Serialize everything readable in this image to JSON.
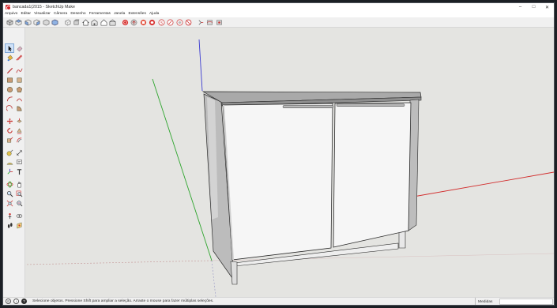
{
  "window": {
    "title": "bancada1(2015 - SketchUp Make",
    "controls": [
      "–",
      "□",
      "✕"
    ]
  },
  "menubar": {
    "items": [
      "Arquivo",
      "Editar",
      "Visualizar",
      "Câmera",
      "Desenho",
      "Ferramentas",
      "Janela",
      "Extensões",
      "Ajuda"
    ]
  },
  "toolbar": {
    "icons": [
      "iso-view-icon",
      "top-view-icon",
      "front-view-icon",
      "right-view-icon",
      "back-view-icon",
      "left-view-icon",
      "xray-style-icon",
      "wireframe-style-icon",
      "hidden-line-style-icon",
      "shaded-style-icon",
      "textured-style-icon",
      "monochrome-style-icon",
      "warehouse-icon",
      "share-model-icon",
      "extension-warehouse-icon",
      "components-icon",
      "layout-icon",
      "ruby-icon",
      "styles-icon",
      "no-entry-icon",
      "sandbox-icon",
      "smoove-icon",
      "drape-icon"
    ]
  },
  "palette": {
    "icons": [
      [
        "select-arrow-icon",
        "eraser-icon"
      ],
      [
        "paint-bucket-icon",
        "tape-measure-icon"
      ],
      [
        "pencil-line-icon",
        "freehand-icon"
      ],
      [
        "rectangle-icon",
        "rotated-rectangle-icon"
      ],
      [
        "circle-icon",
        "polygon-icon"
      ],
      [
        "arc-icon",
        "two-point-arc-icon"
      ],
      [
        "three-point-arc-icon",
        "pie-icon"
      ],
      [
        "move-icon",
        "push-pull-icon"
      ],
      [
        "rotate-icon",
        "follow-me-icon"
      ],
      [
        "scale-icon",
        "offset-icon"
      ],
      [
        "tape-measure-tool-icon",
        "dimension-icon"
      ],
      [
        "protractor-icon",
        "text-icon"
      ],
      [
        "axes-icon",
        "3d-text-icon"
      ],
      [
        "orbit-icon",
        "pan-icon"
      ],
      [
        "zoom-icon",
        "zoom-window-icon"
      ],
      [
        "zoom-extents-icon",
        "previous-view-icon"
      ],
      [
        "position-camera-icon",
        "look-around-icon"
      ],
      [
        "walk-icon",
        "section-plane-icon"
      ]
    ]
  },
  "status": {
    "message": "Selecione objetos. Pressione Shift para ampliar a seleção. Arraste o mouse para fazer múltiplas seleções.",
    "measurements_label": "Medidas",
    "icons": [
      "geo-location-icon",
      "credits-icon",
      "help-icon"
    ]
  },
  "colors": {
    "sky": "#e4e4e1",
    "cabinet_face": "#f6f6f6",
    "cabinet_side": "#bcbcbc",
    "countertop": "#a9a9a9",
    "axis_red": "#d22c2c",
    "axis_green": "#2ea52e",
    "axis_blue": "#3b3bd1"
  }
}
